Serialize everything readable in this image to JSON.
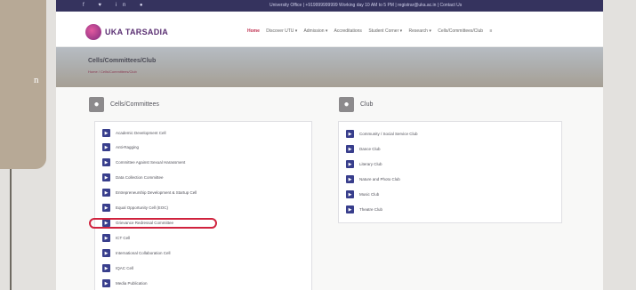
{
  "side_panel": {
    "text": "n"
  },
  "topbar": {
    "social": "f ♥ in ●",
    "info": "University Office | +919999999999 Working day 10 AM to 5 PM | registrar@uka.ac.in | Contact Us"
  },
  "header": {
    "logo_text": "UKA TARSADIA",
    "nav_items": [
      "Home",
      "Discover UTU ▾",
      "Admission ▾",
      "Accreditations",
      "Student Corner ▾",
      "Research ▾",
      "Cells/Committees/Club",
      "≡"
    ]
  },
  "banner": {
    "title": "Cells/Committees/Club",
    "crumb": "Home / Cells/Committees/Club"
  },
  "sections": {
    "cells": {
      "title": "Cells/Committees"
    },
    "club": {
      "title": "Club"
    }
  },
  "cells_items": [
    "Academic Development Cell",
    "Anti-Ragging",
    "Committee Against Sexual Harassment",
    "Data Collection Committee",
    "Entrepreneurship Development & Startup Cell",
    "Equal Opportunity Cell (EOC)",
    "Grievance Redressal Committee",
    "ICT Cell",
    "International Collaboration Cell",
    "IQAC Cell",
    "Media Publication"
  ],
  "club_items": [
    "Community / Social Service Club",
    "Dance Club",
    "Literary Club",
    "Nature and Photo Club",
    "Music Club",
    "Theatre Club"
  ],
  "colors": {
    "topbar": "#35335e",
    "accent": "#bf2f4f",
    "bullet": "#383e8c",
    "highlight": "#d0233e"
  },
  "icons": {
    "section": "group-icon",
    "item": "square-bullet-icon"
  }
}
